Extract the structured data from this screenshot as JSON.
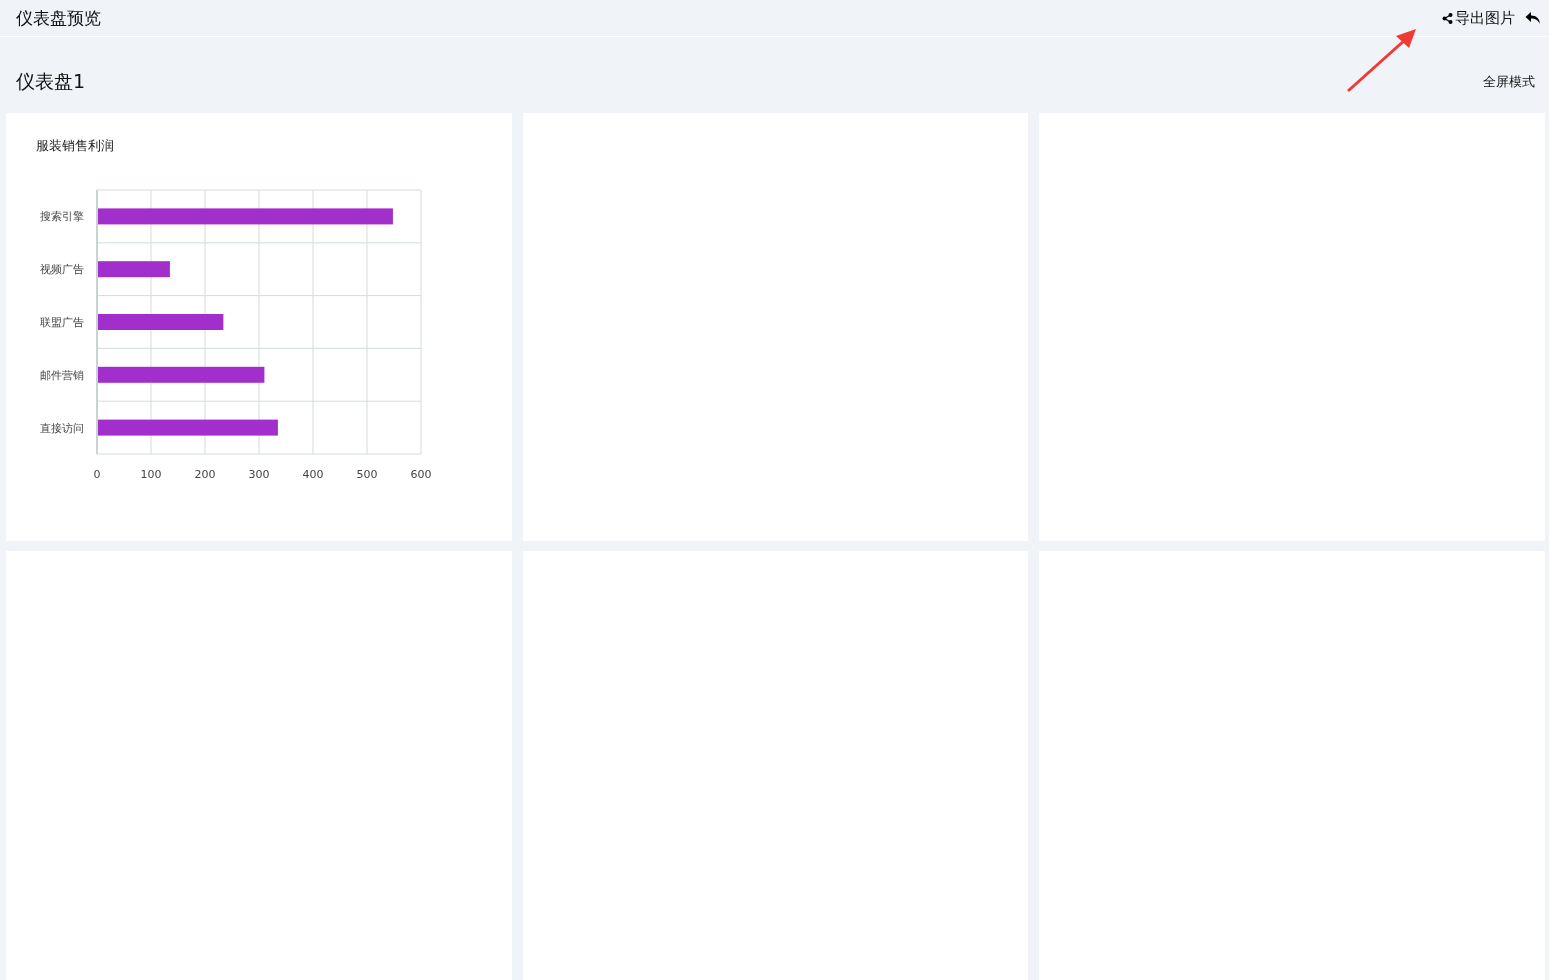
{
  "header": {
    "title": "仪表盘预览",
    "export_label": "导出图片"
  },
  "dashboard": {
    "title": "仪表盘1",
    "fullscreen_label": "全屏模式"
  },
  "panels": [
    {
      "kind": "chart",
      "title": "服装销售利润",
      "chart_data": {
        "type": "bar",
        "orientation": "horizontal",
        "categories": [
          "搜索引擎",
          "视频广告",
          "联盟广告",
          "邮件营销",
          "直接访问"
        ],
        "series": [
          {
            "color": "#a22ecb",
            "values": [
              548,
              135,
              234,
              310,
              335
            ]
          }
        ],
        "grid": true,
        "xlim": [
          0,
          600
        ],
        "xticks": [
          0,
          100,
          200,
          300,
          400,
          500,
          600
        ]
      }
    },
    {
      "kind": "empty"
    },
    {
      "kind": "empty"
    },
    {
      "kind": "empty"
    },
    {
      "kind": "empty"
    },
    {
      "kind": "empty"
    }
  ]
}
